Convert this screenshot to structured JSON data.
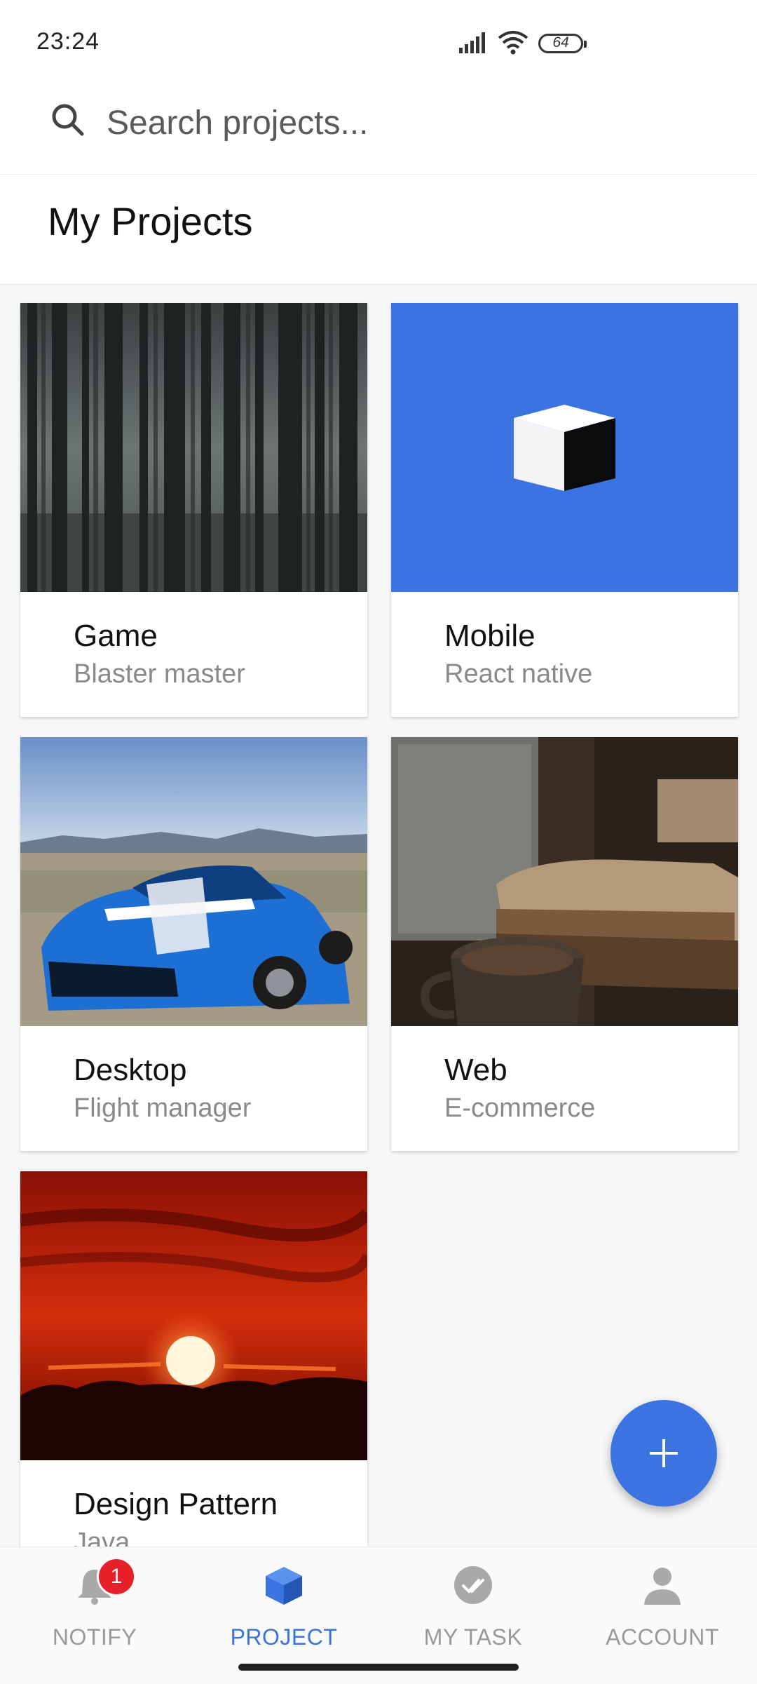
{
  "status_bar": {
    "time": "23:24",
    "battery": "64"
  },
  "search": {
    "placeholder": "Search projects..."
  },
  "header": {
    "title": "My Projects"
  },
  "projects": [
    {
      "title": "Game",
      "subtitle": "Blaster master",
      "image": "forest-photo"
    },
    {
      "title": "Mobile",
      "subtitle": "React native",
      "image": "cube-logo"
    },
    {
      "title": "Desktop",
      "subtitle": "Flight manager",
      "image": "blue-car-photo"
    },
    {
      "title": "Web",
      "subtitle": "E-commerce",
      "image": "coffee-books-photo"
    },
    {
      "title": "Design Pattern",
      "subtitle": "Java",
      "image": "sunset-photo"
    }
  ],
  "fab": {
    "icon": "plus-icon"
  },
  "nav": {
    "items": [
      {
        "label": "NOTIFY",
        "icon": "bell-icon",
        "badge": "1"
      },
      {
        "label": "PROJECT",
        "icon": "cube-icon"
      },
      {
        "label": "MY TASK",
        "icon": "double-check-icon"
      },
      {
        "label": "ACCOUNT",
        "icon": "person-icon"
      }
    ],
    "active": "PROJECT"
  },
  "colors": {
    "accent": "#3b74e0",
    "badge": "#e8202a",
    "mobile_card_bg": "#3b74e0"
  }
}
